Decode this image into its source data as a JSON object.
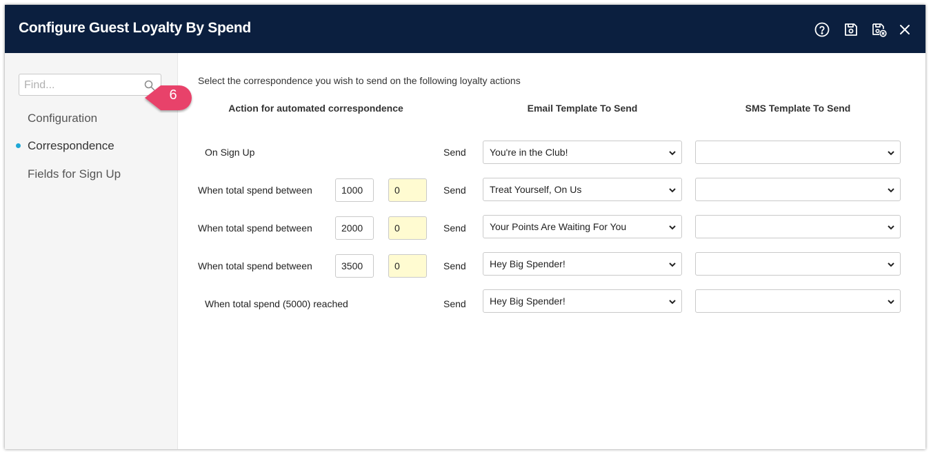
{
  "window": {
    "title": "Configure Guest Loyalty By Spend"
  },
  "header_icons": [
    "help-icon",
    "save-icon",
    "save-close-icon",
    "close-icon"
  ],
  "sidebar": {
    "search_placeholder": "Find...",
    "items": [
      {
        "label": "Configuration",
        "active": false
      },
      {
        "label": "Correspondence",
        "active": true
      },
      {
        "label": "Fields for Sign Up",
        "active": false
      }
    ],
    "callout_number": "6"
  },
  "main": {
    "intro": "Select the correspondence you wish to send on the following loyalty actions",
    "headers": {
      "action": "Action for automated correspondence",
      "email": "Email Template To Send",
      "sms": "SMS Template To Send"
    },
    "rows": [
      {
        "label": "On Sign Up",
        "send": "Send",
        "email": "You're in the Club!",
        "sms": ""
      },
      {
        "label": "When total spend between",
        "from": "1000",
        "to": "0",
        "send": "Send",
        "email": "Treat Yourself, On Us",
        "sms": ""
      },
      {
        "label": "When total spend between",
        "from": "2000",
        "to": "0",
        "send": "Send",
        "email": "Your Points Are Waiting For You",
        "sms": ""
      },
      {
        "label": "When total spend between",
        "from": "3500",
        "to": "0",
        "send": "Send",
        "email": "Hey Big Spender!",
        "sms": ""
      },
      {
        "label": "When total spend (5000) reached",
        "send": "Send",
        "email": "Hey Big Spender!",
        "sms": ""
      }
    ]
  },
  "colors": {
    "header_bg": "#0b1f3f",
    "accent_dot": "#1fa8d6",
    "callout": "#e8436a",
    "highlight_input": "#fffbd1"
  }
}
